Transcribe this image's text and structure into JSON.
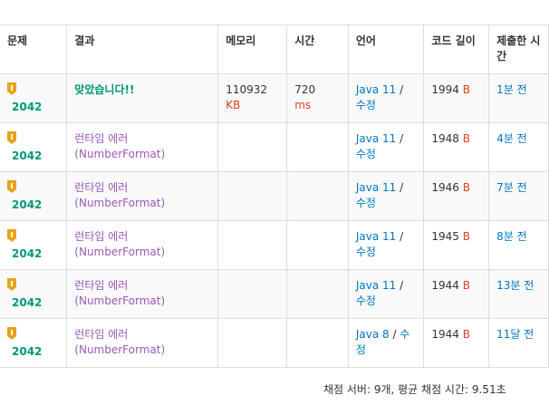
{
  "headers": {
    "problem": "문제",
    "result": "결과",
    "memory": "메모리",
    "time": "시간",
    "language": "언어",
    "code_length": "코드 길이",
    "submitted": "제출한 시간"
  },
  "rows": [
    {
      "problem_id": "2042",
      "result": "맞았습니다!!",
      "memory": "110932",
      "memory_unit": "KB",
      "time": "720",
      "time_unit": "ms",
      "lang": "Java 11",
      "edit": "수정",
      "code": "1994",
      "code_unit": "B",
      "ago": "1분 전"
    },
    {
      "problem_id": "2042",
      "result": "런타임 에러 (NumberFormat)",
      "memory": "",
      "memory_unit": "",
      "time": "",
      "time_unit": "",
      "lang": "Java 11",
      "edit": "수정",
      "code": "1948",
      "code_unit": "B",
      "ago": "4분 전"
    },
    {
      "problem_id": "2042",
      "result": "런타임 에러 (NumberFormat)",
      "memory": "",
      "memory_unit": "",
      "time": "",
      "time_unit": "",
      "lang": "Java 11",
      "edit": "수정",
      "code": "1946",
      "code_unit": "B",
      "ago": "7분 전"
    },
    {
      "problem_id": "2042",
      "result": "런타임 에러 (NumberFormat)",
      "memory": "",
      "memory_unit": "",
      "time": "",
      "time_unit": "",
      "lang": "Java 11",
      "edit": "수정",
      "code": "1945",
      "code_unit": "B",
      "ago": "8분 전"
    },
    {
      "problem_id": "2042",
      "result": "런타임 에러 (NumberFormat)",
      "memory": "",
      "memory_unit": "",
      "time": "",
      "time_unit": "",
      "lang": "Java 11",
      "edit": "수정",
      "code": "1944",
      "code_unit": "B",
      "ago": "13분 전"
    },
    {
      "problem_id": "2042",
      "result": "런타임 에러 (NumberFormat)",
      "memory": "",
      "memory_unit": "",
      "time": "",
      "time_unit": "",
      "lang": "Java 8",
      "edit": "수정",
      "code": "1944",
      "code_unit": "B",
      "ago": "11달 전"
    }
  ],
  "footer": "채점 서버: 9개, 평균 채점 시간: 9.51초",
  "colors": {
    "accepted": "#009874",
    "runtime_error": "#9b59b6",
    "unit": "#dd4124",
    "link": "#0076c0",
    "tier_badge": "#e8a317"
  }
}
